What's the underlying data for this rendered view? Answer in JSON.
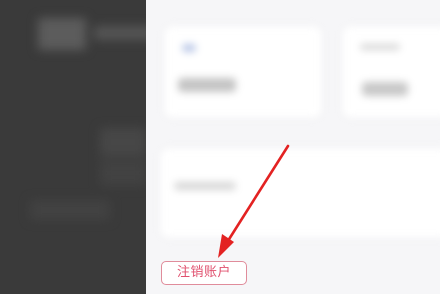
{
  "cancel_account": {
    "label": "注销账户"
  },
  "colors": {
    "accent": "#e0506e",
    "accent_border": "#e08c9b",
    "arrow": "#e32222",
    "overlay": "#3a3a3a",
    "background": "#f7f7f9"
  },
  "icons": {
    "annotation": "red-arrow-pointer"
  }
}
